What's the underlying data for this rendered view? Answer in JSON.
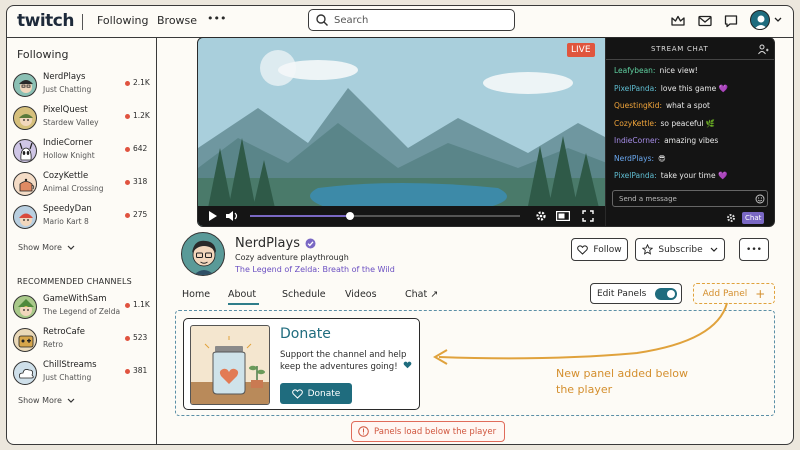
{
  "nav": {
    "logo": "twitch",
    "following": "Following",
    "browse": "Browse",
    "more": "•••",
    "search_placeholder": "Search"
  },
  "sidebar": {
    "following_title": "Following",
    "following": [
      {
        "name": "NerdPlays",
        "game": "Just Chatting",
        "viewers": "2.1K"
      },
      {
        "name": "PixelQuest",
        "game": "Stardew Valley",
        "viewers": "1.2K"
      },
      {
        "name": "IndieCorner",
        "game": "Hollow Knight",
        "viewers": "642"
      },
      {
        "name": "CozyKettle",
        "game": "Animal Crossing",
        "viewers": "318"
      },
      {
        "name": "SpeedyDan",
        "game": "Mario Kart 8",
        "viewers": "275"
      }
    ],
    "show_more": "Show More",
    "recommended_title": "RECOMMENDED CHANNELS",
    "recommended": [
      {
        "name": "GameWithSam",
        "game": "The Legend of Zelda",
        "viewers": "1.1K"
      },
      {
        "name": "RetroCafe",
        "game": "Retro",
        "viewers": "523"
      },
      {
        "name": "ChillStreams",
        "game": "Just Chatting",
        "viewers": "381"
      }
    ],
    "show_more_2": "Show More"
  },
  "player": {
    "live_label": "LIVE",
    "progress": 0.37
  },
  "chat": {
    "title": "STREAM CHAT",
    "messages": [
      {
        "user": "Leafybean:",
        "text": "nice view!",
        "color": "#5fd0a0"
      },
      {
        "user": "PixelPanda:",
        "text": "love this game 💜",
        "color": "#5fbcd0"
      },
      {
        "user": "QuestingKid:",
        "text": "what a spot",
        "color": "#f0a43a"
      },
      {
        "user": "CozyKettle:",
        "text": "so peaceful 🌿",
        "color": "#f0a43a"
      },
      {
        "user": "IndieCorner:",
        "text": "amazing vibes",
        "color": "#a58ce6"
      },
      {
        "user": "NerdPlays:",
        "text": "😎",
        "color": "#6aa8f0"
      },
      {
        "user": "PixelPanda:",
        "text": "take your time 💜",
        "color": "#5fbcd0"
      }
    ],
    "input_placeholder": "Send a message",
    "chat_button": "Chat"
  },
  "channel": {
    "name": "NerdPlays",
    "title": "Cozy adventure playthrough",
    "game": "The Legend of Zelda: Breath of the Wild",
    "follow_label": "Follow",
    "subscribe_label": "Subscribe",
    "more_label": "•••"
  },
  "tabs": [
    {
      "label": "Home"
    },
    {
      "label": "About"
    },
    {
      "label": "Schedule"
    },
    {
      "label": "Videos"
    },
    {
      "label": "Chat ↗"
    }
  ],
  "active_tab": "About",
  "edit_panels_label": "Edit Panels",
  "edit_panels_on": true,
  "add_panel_label": "Add Panel",
  "donate": {
    "title": "Donate",
    "description": "Support the channel and help keep the adventures going!",
    "button_label": "Donate"
  },
  "annotation": {
    "line1": "New panel added below",
    "line2": "the player"
  },
  "notice": "Panels load below the player",
  "colors": {
    "accent_teal": "#1f6c7e",
    "accent_purple": "#7a68c4",
    "live_red": "#e0553d",
    "annotation_orange": "#d48f2e"
  }
}
